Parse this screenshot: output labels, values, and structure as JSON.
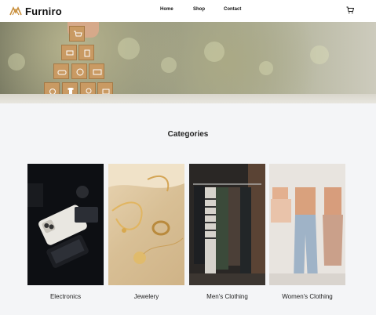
{
  "brand": {
    "name": "Furniro"
  },
  "nav": {
    "home": "Home",
    "shop": "Shop",
    "contact": "Contact"
  },
  "colors": {
    "accent": "#c9903e",
    "background": "#f4f5f7"
  },
  "icons": {
    "logo": "furniro-logo-icon",
    "cart": "cart-icon"
  },
  "categories": {
    "title": "Categories",
    "items": [
      {
        "label": "Electronics"
      },
      {
        "label": "Jewelery"
      },
      {
        "label": "Men's Clothing"
      },
      {
        "label": "Women's Clothing"
      }
    ]
  }
}
